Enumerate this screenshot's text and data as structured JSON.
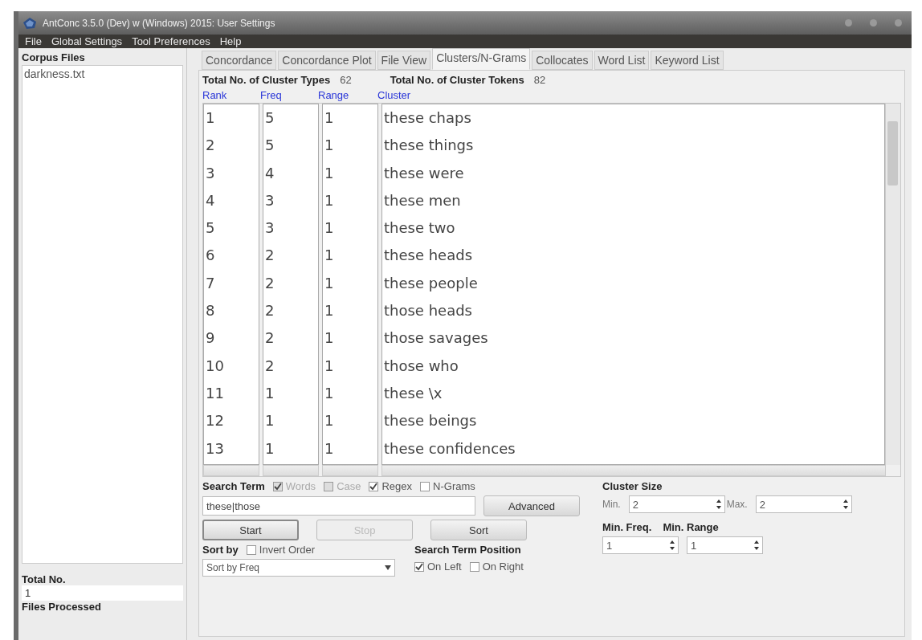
{
  "window": {
    "title": "AntConc 3.5.0 (Dev) w (Windows) 2015: User Settings"
  },
  "menu": [
    "File",
    "Global Settings",
    "Tool Preferences",
    "Help"
  ],
  "sidebar": {
    "title": "Corpus Files",
    "files": [
      "darkness.txt"
    ],
    "total_label": "Total No.",
    "total_value": "1",
    "processed_label": "Files Processed"
  },
  "tabs": [
    {
      "label": "Concordance",
      "selected": false
    },
    {
      "label": "Concordance Plot",
      "selected": false
    },
    {
      "label": "File View",
      "selected": false
    },
    {
      "label": "Clusters/N-Grams",
      "selected": true
    },
    {
      "label": "Collocates",
      "selected": false
    },
    {
      "label": "Word List",
      "selected": false
    },
    {
      "label": "Keyword List",
      "selected": false
    }
  ],
  "totals": [
    {
      "label": "Total No. of Cluster Types",
      "value": "62"
    },
    {
      "label": "Total No. of Cluster Tokens",
      "value": "82"
    }
  ],
  "table": {
    "columns": [
      "Rank",
      "Freq",
      "Range",
      "Cluster"
    ],
    "rows": [
      [
        "1",
        "5",
        "1",
        "these chaps"
      ],
      [
        "2",
        "5",
        "1",
        "these things"
      ],
      [
        "3",
        "4",
        "1",
        "these were"
      ],
      [
        "4",
        "3",
        "1",
        "these men"
      ],
      [
        "5",
        "3",
        "1",
        "these two"
      ],
      [
        "6",
        "2",
        "1",
        "these heads"
      ],
      [
        "7",
        "2",
        "1",
        "these people"
      ],
      [
        "8",
        "2",
        "1",
        "those heads"
      ],
      [
        "9",
        "2",
        "1",
        "those savages"
      ],
      [
        "10",
        "2",
        "1",
        "those who"
      ],
      [
        "11",
        "1",
        "1",
        "these \\x"
      ],
      [
        "12",
        "1",
        "1",
        "these beings"
      ],
      [
        "13",
        "1",
        "1",
        "these confidences"
      ]
    ]
  },
  "search": {
    "label": "Search Term",
    "options": [
      {
        "label": "Words",
        "checked": true,
        "disabled": true
      },
      {
        "label": "Case",
        "checked": false,
        "disabled": true
      },
      {
        "label": "Regex",
        "checked": true,
        "disabled": false
      },
      {
        "label": "N-Grams",
        "checked": false,
        "disabled": false
      }
    ],
    "value": "these|those",
    "advanced": "Advanced"
  },
  "buttons": [
    {
      "label": "Start",
      "disabled": false
    },
    {
      "label": "Stop",
      "disabled": true
    },
    {
      "label": "Sort",
      "disabled": false
    }
  ],
  "sort": {
    "label": "Sort by",
    "invert": {
      "label": "Invert Order",
      "checked": false
    },
    "value": "Sort by Freq"
  },
  "position": {
    "label": "Search Term Position",
    "options": [
      {
        "label": "On Left",
        "checked": true
      },
      {
        "label": "On Right",
        "checked": false
      }
    ]
  },
  "cluster_size": {
    "label": "Cluster Size",
    "min_label": "Min.",
    "min": "2",
    "max_label": "Max.",
    "max": "2"
  },
  "min_freq": {
    "label": "Min. Freq.",
    "value": "1"
  },
  "min_range": {
    "label": "Min. Range",
    "value": "1"
  }
}
